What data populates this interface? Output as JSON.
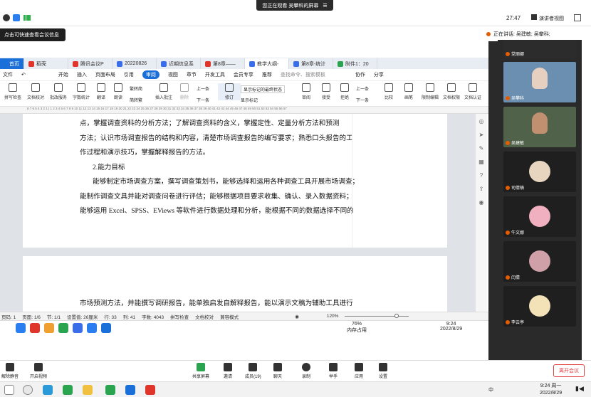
{
  "banner": {
    "text": "您正在观看 吴攀科的屏幕",
    "icon": "collapse-icon"
  },
  "topbar": {
    "time": "27:47",
    "presenter_view": "演讲者视图",
    "layout_icon": "grid-icon"
  },
  "tip": {
    "text": "点击可快速查看会议信息"
  },
  "speaking": {
    "text": "正在讲话: 吴建敏; 吴攀科;"
  },
  "wps_tabs": [
    {
      "label": "首页",
      "color": "#1a6fd8"
    },
    {
      "label": "稻壳",
      "color": "#e0352b"
    },
    {
      "label": "腾讯会议P",
      "color": "#e0352b"
    },
    {
      "label": "20220826",
      "color": "#3a6ee8"
    },
    {
      "label": "近期信息系",
      "color": "#3a6ee8"
    },
    {
      "label": "第8章——",
      "color": "#e0352b"
    },
    {
      "label": "教学大纲-",
      "color": "#3a6ee8"
    },
    {
      "label": "第8章-统计",
      "color": "#3a6ee8"
    },
    {
      "label": "附件1：20",
      "color": "#2aa44f"
    }
  ],
  "menu": {
    "file": "文件",
    "start": "开始",
    "insert": "插入",
    "layout": "页面布局",
    "ref": "引用",
    "review": "审阅",
    "view": "视图",
    "section": "章节",
    "dev": "开发工具",
    "member": "会员专享",
    "recommend": "推荐",
    "search": "查找命令、搜索模板",
    "cowork": "协作",
    "share": "分享"
  },
  "ribbon": {
    "spell": "拼写检查",
    "doccheck": "文档校对",
    "batch": "批改服务",
    "wordcount": "字数统计",
    "translate": "翻译",
    "read": "朗读",
    "trad": "繁转简",
    "simp": "简转繁",
    "insertcomment": "插入批注",
    "del": "删除",
    "prev": "上一条",
    "next": "下一条",
    "revise": "修订",
    "showmarkup": "显示标记的最终状态",
    "showmark": "显示标记",
    "review": "审阅",
    "accept": "接受",
    "reject": "拒绝",
    "prev2": "上一条",
    "next2": "下一条",
    "compare": "比较",
    "ink": "画笔",
    "restrict": "限制编辑",
    "doccert": "文档权限",
    "docauth": "文档认证"
  },
  "ruler": "8 7 6 5 4 3 2 1 | 1 2 3 4 5 6 7 8 9 10 11 12 13 14 15 16 17 18 19 20 21 22 23 24 25 26 27 28 29 30 31 32 33 34 35 36 37 38 39 40 41 42 43 44 45 46 47 48 49 50 51 52 53 54 55 56 57",
  "doc": {
    "line1": "点，掌握调查资料的分析方法；了解调查资料的含义，掌握定性、定量分析方法和预测",
    "line2": "方法；认识市场调查报告的结构和内容，清楚市场调查报告的编写要求；熟悉口头报告的工",
    "line3": "作过程和演示技巧，掌握解释报告的方法。",
    "heading": "2.能力目标",
    "line4": "能够制定市场调查方案，撰写调查策划书，能够选择和运用各种调查工具开展市场调查；",
    "line5": "能制作调查文具并能对调查问卷进行评估；能够根据项目要求收集、确认、录入数据资料；",
    "line6": "能够运用 Excel、SPSS、EViews 等软件进行数据处理和分析，能根据不同的数据选择不同的",
    "next_page": "市场预测方法，并能撰写调研报告，能单独启发自解释报告，能以演示文稿为辅助工具进行"
  },
  "status": {
    "page": "页码: 1",
    "pages": "页面: 1/6",
    "section": "节: 1/1",
    "setting": "设置值: 26厘米",
    "row": "行: 33",
    "col": "列: 41",
    "words": "字数: 4043",
    "spell": "拼写检查",
    "proof": "文档校对",
    "mode": "兼容模式",
    "zoom": "120%"
  },
  "inner_tray": {
    "mem_pct": "76%",
    "mem_label": "内存占用",
    "time": "9:24",
    "date": "2022/8/29"
  },
  "participants": [
    {
      "name": "党丽娜",
      "bg": "#2c2c2c"
    },
    {
      "name": "吴攀科",
      "bg": "#6a8fb0"
    },
    {
      "name": "吴建敏",
      "bg": "#50624a"
    },
    {
      "name": "司倩楠",
      "bg": "#1f1f1f"
    },
    {
      "name": "牛文娜",
      "bg": "#1f1f1f"
    },
    {
      "name": "闫倩",
      "bg": "#1f1f1f"
    },
    {
      "name": "李云亭",
      "bg": "#1f1f1f"
    }
  ],
  "meeting": {
    "mute": "解除静音",
    "video": "开启视频",
    "share": "共享屏幕",
    "invite": "邀请",
    "members": "成员(19)",
    "chat": "聊天",
    "record": "录制",
    "raise": "举手",
    "apps": "应用",
    "settings": "设置",
    "leave": "离开会议"
  },
  "wintray": {
    "time": "9:24 周一",
    "date": "2022/8/29",
    "ime": "中"
  }
}
